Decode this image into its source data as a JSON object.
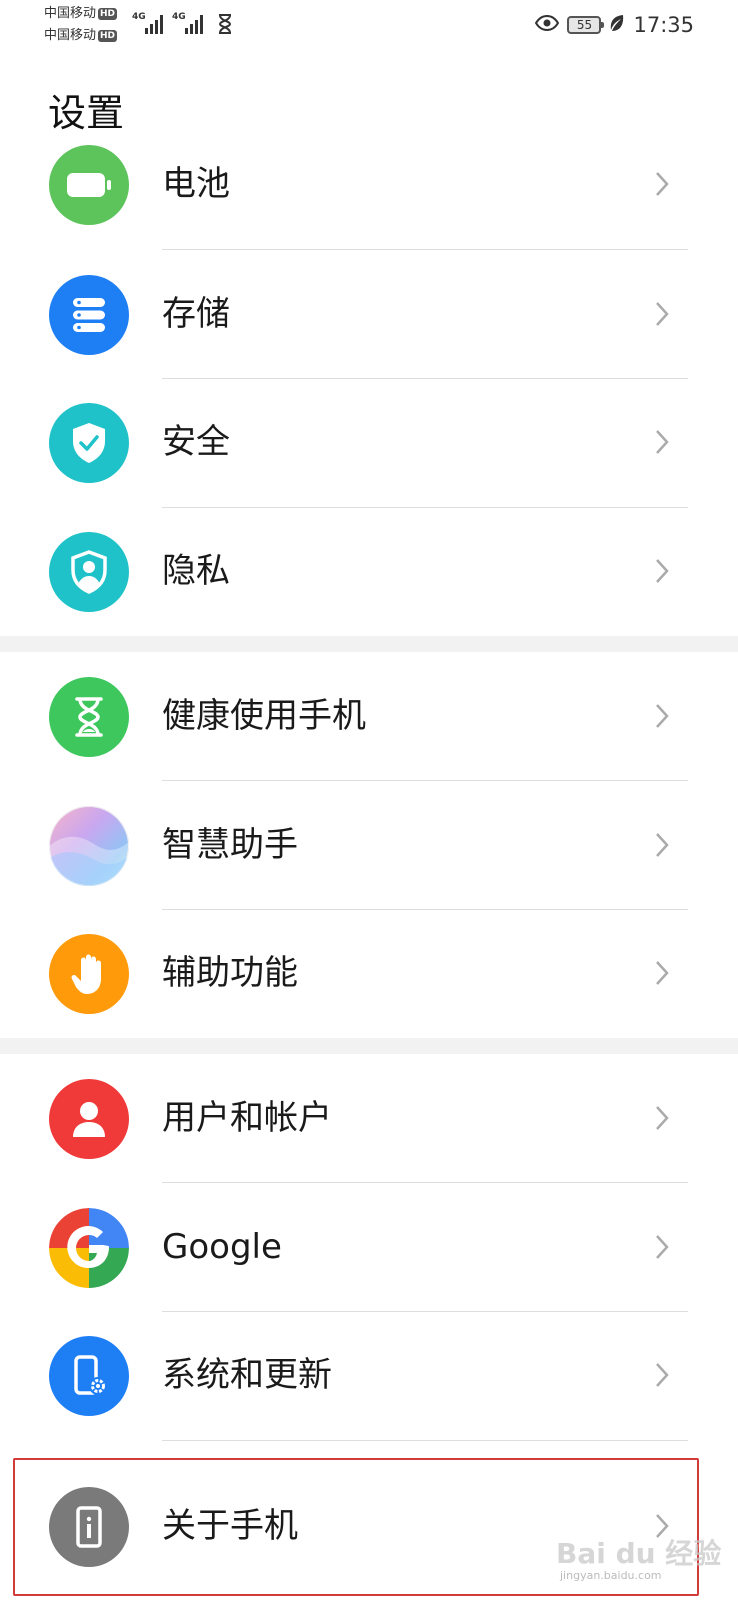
{
  "status_bar": {
    "carrier_1": "中国移动",
    "carrier_2": "中国移动",
    "hd_label": "HD",
    "network_1": "4G",
    "network_2": "4G",
    "battery_level": "55",
    "time": "17:35"
  },
  "page_title": "设置",
  "rows": [
    {
      "label": "电池",
      "icon": "battery-icon",
      "color": "#5cc45a"
    },
    {
      "label": "存储",
      "icon": "storage-icon",
      "color": "#1e7ff5"
    },
    {
      "label": "安全",
      "icon": "shield-check-icon",
      "color": "#1fc2c8"
    },
    {
      "label": "隐私",
      "icon": "privacy-user-shield-icon",
      "color": "#1fc2c8"
    },
    {
      "label": "健康使用手机",
      "icon": "hourglass-icon",
      "color": "#3dc75d"
    },
    {
      "label": "智慧助手",
      "icon": "smart-assistant-icon",
      "color": "#c8a7e6"
    },
    {
      "label": "辅助功能",
      "icon": "hand-icon",
      "color": "#ff9a0a"
    },
    {
      "label": "用户和帐户",
      "icon": "user-icon",
      "color": "#f03a3a"
    },
    {
      "label": "Google",
      "icon": "google-icon",
      "color": "#4285f4"
    },
    {
      "label": "系统和更新",
      "icon": "phone-gear-icon",
      "color": "#1e7ff5"
    },
    {
      "label": "关于手机",
      "icon": "phone-info-icon",
      "color": "#7a7a7a"
    }
  ],
  "watermark": {
    "brand": "Bai du 经验",
    "url": "jingyan.baidu.com"
  }
}
